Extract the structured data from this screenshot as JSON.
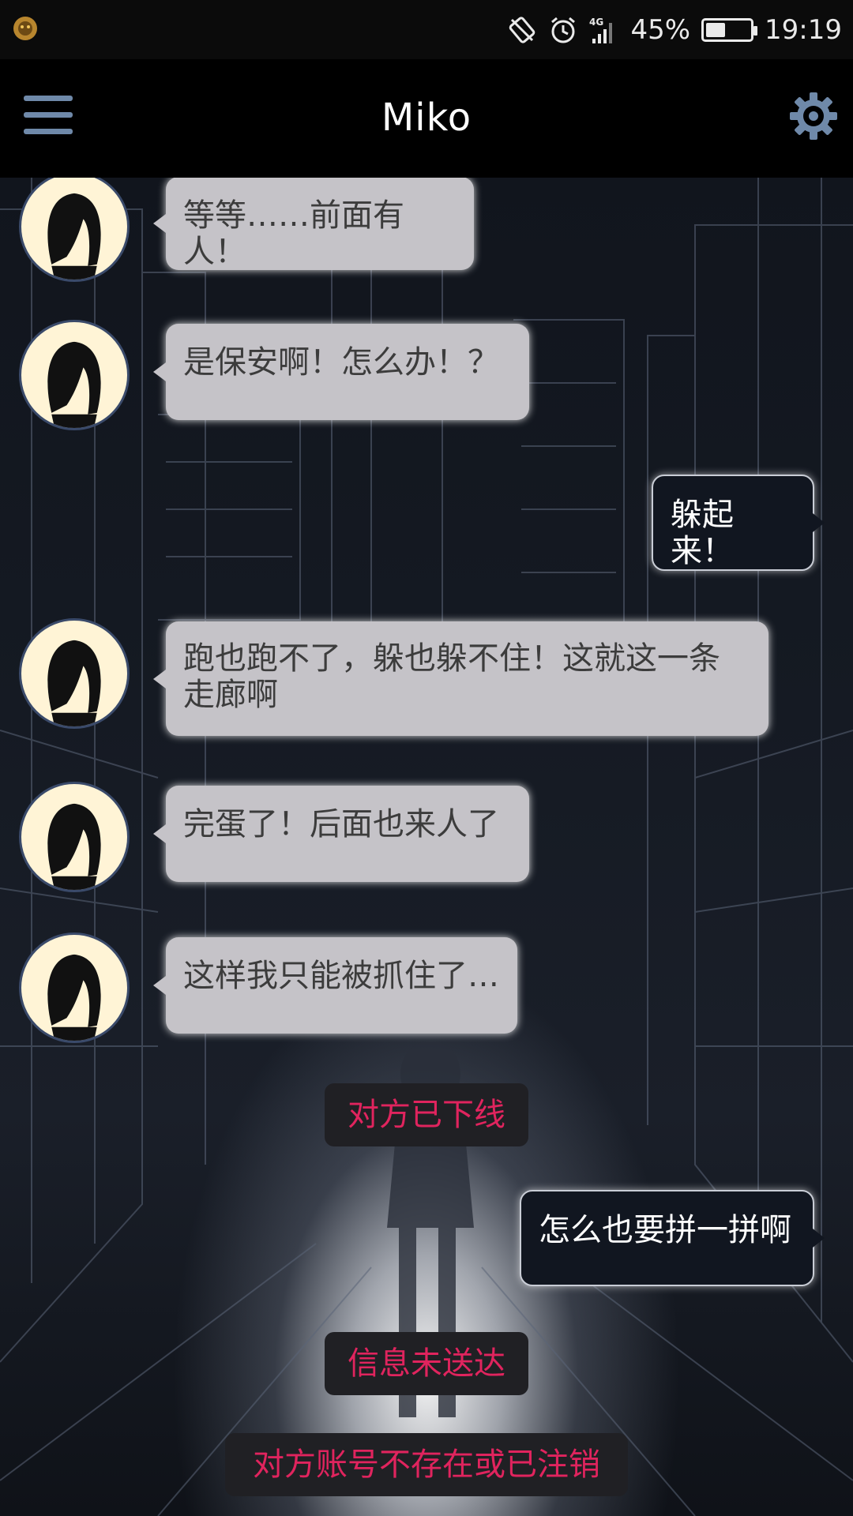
{
  "status_bar": {
    "battery_percent": "45%",
    "battery_level": 0.45,
    "time": "19:19",
    "network": "4G",
    "icons": [
      "app-notification-icon",
      "rotation-lock-icon",
      "alarm-icon",
      "signal-4g-icon",
      "battery-icon"
    ]
  },
  "app_bar": {
    "title": "Miko",
    "left_icon": "menu-icon",
    "right_icon": "gear-icon",
    "icon_color": "#6f89a9"
  },
  "messages": [
    {
      "side": "left",
      "text": "等等……前面有人！"
    },
    {
      "side": "left",
      "text": "是保安啊！怎么办！？"
    },
    {
      "side": "right",
      "text": "躲起来！"
    },
    {
      "side": "left",
      "text": "跑也跑不了，躲也躲不住！这就这一条走廊啊"
    },
    {
      "side": "left",
      "text": "完蛋了！后面也来人了"
    },
    {
      "side": "left",
      "text": "这样我只能被抓住了…"
    },
    {
      "side": "system",
      "text": "对方已下线"
    },
    {
      "side": "right",
      "text": "怎么也要拼一拼啊"
    },
    {
      "side": "system",
      "text": "信息未送达"
    },
    {
      "side": "system",
      "text": "对方账号不存在或已注销"
    }
  ],
  "colors": {
    "left_bubble": "#c5c3c8",
    "right_bubble": "#111620",
    "system_text": "#e0245e",
    "avatar_bg": "#fff4d6"
  }
}
